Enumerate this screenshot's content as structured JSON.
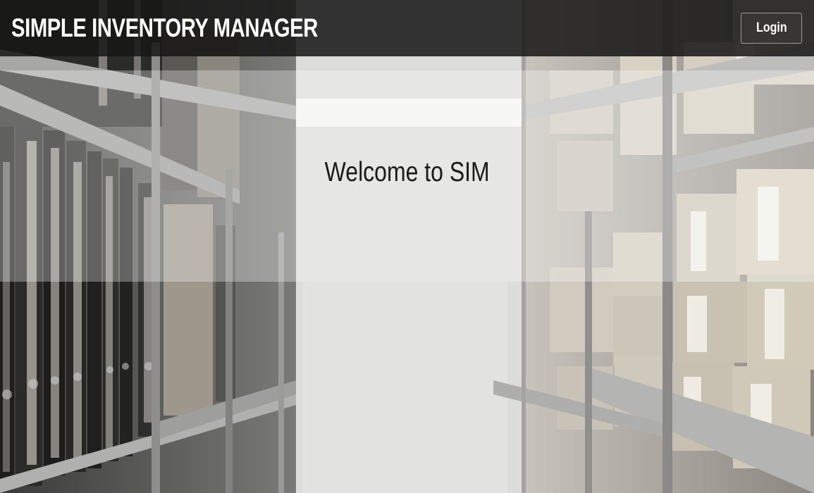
{
  "header": {
    "brand": "SIMPLE INVENTORY MANAGER",
    "login_label": "Login"
  },
  "hero": {
    "heading": "Welcome to SIM"
  },
  "background": {
    "description_icon": "warehouse-shelves-photo"
  }
}
